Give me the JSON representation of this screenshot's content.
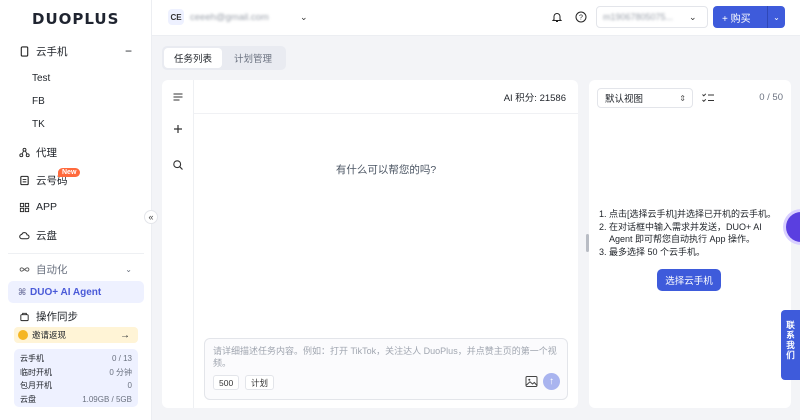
{
  "brand": {
    "logo_text": "DUOPLUS"
  },
  "sidebar": {
    "cloud_phone": {
      "label": "云手机",
      "toggle": "−"
    },
    "groups": [
      {
        "label": "Test"
      },
      {
        "label": "FB"
      },
      {
        "label": "TK"
      }
    ],
    "proxy": {
      "label": "代理"
    },
    "cloud_number": {
      "label": "云号码",
      "badge": "New"
    },
    "app": {
      "label": "APP"
    },
    "cloud_disk": {
      "label": "云盘"
    },
    "automation": {
      "label": "自动化"
    },
    "agent": {
      "label": "DUO+ AI Agent"
    },
    "sync": {
      "label": "操作同步"
    },
    "invite": {
      "label": "邀请返现",
      "arrow": "→"
    },
    "stats": [
      {
        "label": "云手机",
        "value": "0 / 13"
      },
      {
        "label": "临时开机",
        "value": "0 分钟"
      },
      {
        "label": "包月开机",
        "value": "0"
      },
      {
        "label": "云盘",
        "value": "1.09GB / 5GB"
      }
    ],
    "collapse_glyph": "«"
  },
  "topbar": {
    "avatar_initials": "CE",
    "account_email": "ceeeh@gmail.com",
    "phone_select": "m19067805075...",
    "buy_label": "+ 购买"
  },
  "tabs": [
    {
      "label": "任务列表"
    },
    {
      "label": "计划管理"
    }
  ],
  "chat": {
    "score": "AI 积分: 21586",
    "prompt": "有什么可以帮您的吗?",
    "placeholder": "请详细描述任务内容。例如：打开 TikTok，关注达人 DuoPlus，并点赞主页的第一个视频。",
    "chip_count": "500",
    "chip_plan": "计划",
    "send_glyph": "↑"
  },
  "right_panel": {
    "view_label": "默认视图",
    "count": "0 / 50",
    "steps": [
      {
        "n": "1.",
        "text": "点击[选择云手机]并选择已开机的云手机。"
      },
      {
        "n": "2.",
        "text": "在对话框中输入需求并发送，DUO+ AI Agent 即可帮您自动执行 App 操作。"
      },
      {
        "n": "3.",
        "text": "最多选择 50 个云手机。"
      }
    ],
    "select_button": "选择云手机"
  },
  "contact": {
    "chars": [
      "联",
      "系",
      "我",
      "们"
    ]
  },
  "colors": {
    "primary": "#3e5bdb",
    "sidebar_active": "#eef1ff",
    "badge": "#ff6a3d"
  }
}
